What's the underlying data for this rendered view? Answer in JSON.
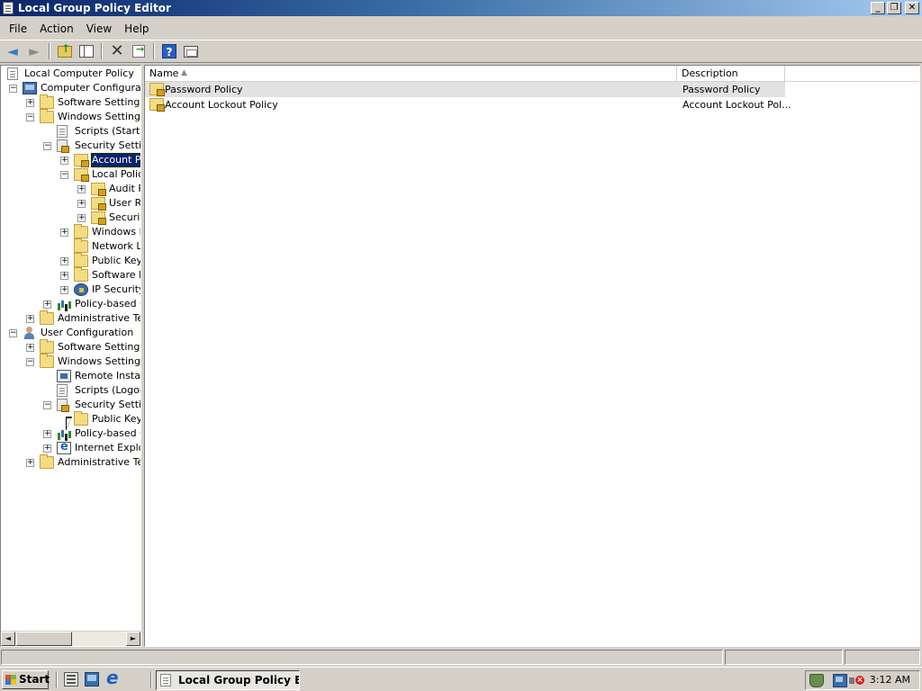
{
  "window": {
    "title": "Local Group Policy Editor",
    "minimize": "_",
    "restore": "❐",
    "close": "✕"
  },
  "menu": [
    "File",
    "Action",
    "View",
    "Help"
  ],
  "toolbar": {
    "back": "◄",
    "forward": "►",
    "delete": "✕",
    "help": "?"
  },
  "tree": {
    "expand_symbol": "+",
    "collapse_symbol": "−",
    "rows": [
      {
        "label": "Local Computer Policy",
        "level": 0,
        "expander": "none",
        "icon": "doc-icon"
      },
      {
        "label": "Computer Configuration",
        "level": 0,
        "expander": "minus",
        "icon": "computer-icon"
      },
      {
        "label": "Software Settings",
        "level": 1,
        "expander": "plus",
        "icon": "folder-icon"
      },
      {
        "label": "Windows Settings",
        "level": 1,
        "expander": "minus",
        "icon": "folder-icon"
      },
      {
        "label": "Scripts (Startup",
        "level": 2,
        "expander": "none",
        "icon": "doc-icon"
      },
      {
        "label": "Security Settings",
        "level": 2,
        "expander": "minus",
        "icon": "security-icon"
      },
      {
        "label": "Account Po",
        "level": 3,
        "expander": "plus",
        "icon": "folder-lock-icon",
        "selected": true
      },
      {
        "label": "Local Policies",
        "level": 3,
        "expander": "minus",
        "icon": "folder-lock-icon"
      },
      {
        "label": "Audit P",
        "level": 4,
        "expander": "plus",
        "icon": "folder-lock-icon"
      },
      {
        "label": "User Ri",
        "level": 4,
        "expander": "plus",
        "icon": "folder-lock-icon"
      },
      {
        "label": "Securit",
        "level": 4,
        "expander": "plus",
        "icon": "folder-lock-icon"
      },
      {
        "label": "Windows F",
        "level": 3,
        "expander": "plus",
        "icon": "folder-icon"
      },
      {
        "label": "Network Lis",
        "level": 3,
        "expander": "none",
        "icon": "folder-icon"
      },
      {
        "label": "Public Key I",
        "level": 3,
        "expander": "plus",
        "icon": "folder-icon"
      },
      {
        "label": "Software R",
        "level": 3,
        "expander": "plus",
        "icon": "folder-icon"
      },
      {
        "label": "IP Security",
        "level": 3,
        "expander": "plus",
        "icon": "ipsec-icon"
      },
      {
        "label": "Policy-based Q",
        "level": 2,
        "expander": "plus",
        "icon": "chart-icon"
      },
      {
        "label": "Administrative Tem",
        "level": 1,
        "expander": "plus",
        "icon": "folder-icon"
      },
      {
        "label": "User Configuration",
        "level": 0,
        "expander": "minus",
        "icon": "user-icon"
      },
      {
        "label": "Software Settings",
        "level": 1,
        "expander": "plus",
        "icon": "folder-icon"
      },
      {
        "label": "Windows Settings",
        "level": 1,
        "expander": "minus",
        "icon": "folder-icon"
      },
      {
        "label": "Remote Installa",
        "level": 2,
        "expander": "none",
        "icon": "remote-icon"
      },
      {
        "label": "Scripts (Logon/",
        "level": 2,
        "expander": "none",
        "icon": "doc-icon"
      },
      {
        "label": "Security Settings",
        "level": 2,
        "expander": "minus",
        "icon": "security-icon"
      },
      {
        "label": "Public Key I",
        "level": 3,
        "expander": "none",
        "icon": "folder-icon"
      },
      {
        "label": "Policy-based Q",
        "level": 2,
        "expander": "plus",
        "icon": "chart-icon"
      },
      {
        "label": "Internet Explor",
        "level": 2,
        "expander": "plus",
        "icon": "ie-icon"
      },
      {
        "label": "Administrative Tem",
        "level": 1,
        "expander": "plus",
        "icon": "folder-icon"
      }
    ]
  },
  "list": {
    "columns": {
      "name": "Name",
      "description": "Description",
      "sort_arrow": "▲"
    },
    "rows": [
      {
        "name": "Password Policy",
        "description": "Password Policy",
        "icon": "folder-lock-icon"
      },
      {
        "name": "Account Lockout Policy",
        "description": "Account Lockout Pol...",
        "icon": "folder-lock-icon"
      }
    ]
  },
  "scrollbar": {
    "left_arrow": "◄",
    "right_arrow": "►"
  },
  "taskbar": {
    "start_label": "Start",
    "task_label": "Local Group Policy Edi...",
    "clock": "3:12 AM"
  }
}
